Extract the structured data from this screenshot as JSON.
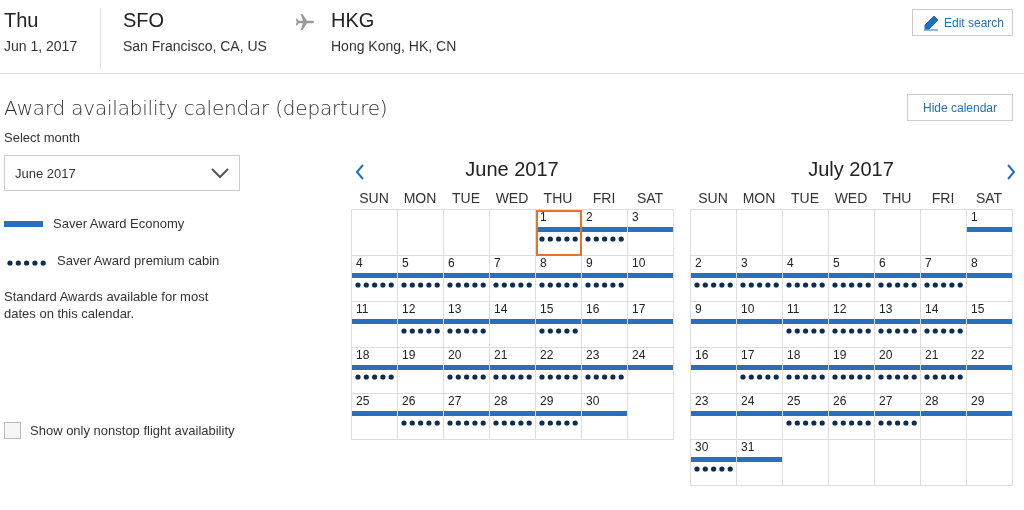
{
  "trip": {
    "day": "Thu",
    "date": "Jun 1, 2017",
    "origin_code": "SFO",
    "origin_city": "San Francisco, CA, US",
    "destination_code": "HKG",
    "destination_city": "Hong Kong, HK, CN"
  },
  "edit_button": "Edit search",
  "title": "Award availability calendar (departure)",
  "hide_button": "Hide calendar",
  "month_select": {
    "label": "Select month",
    "value": "June 2017"
  },
  "legend": [
    {
      "kind": "bar",
      "label": "Saver Award Economy"
    },
    {
      "kind": "dots",
      "label": "Saver Award premium cabin"
    }
  ],
  "note": "Standard Awards available for most dates on this calendar.",
  "nonstop": {
    "label": "Show only nonstop flight availability",
    "checked": false
  },
  "months": [
    {
      "title": "June 2017",
      "weekdays": [
        "SUN",
        "MON",
        "TUE",
        "WED",
        "THU",
        "FRI",
        "SAT"
      ],
      "weeks": [
        {
          "cells": [
            {
              "kind": "empty"
            },
            {
              "kind": "empty"
            },
            {
              "kind": "empty"
            },
            {
              "kind": "empty"
            },
            {
              "kind": "day",
              "day": "1",
              "economy": true,
              "premium": true,
              "selected": true
            },
            {
              "kind": "day",
              "day": "2",
              "economy": true,
              "premium": true,
              "selected": false
            },
            {
              "kind": "day",
              "day": "3",
              "economy": true,
              "premium": false,
              "selected": false
            }
          ]
        },
        {
          "cells": [
            {
              "kind": "day",
              "day": "4",
              "economy": true,
              "premium": true,
              "selected": false
            },
            {
              "kind": "day",
              "day": "5",
              "economy": true,
              "premium": true,
              "selected": false
            },
            {
              "kind": "day",
              "day": "6",
              "economy": true,
              "premium": true,
              "selected": false
            },
            {
              "kind": "day",
              "day": "7",
              "economy": true,
              "premium": true,
              "selected": false
            },
            {
              "kind": "day",
              "day": "8",
              "economy": true,
              "premium": true,
              "selected": false
            },
            {
              "kind": "day",
              "day": "9",
              "economy": true,
              "premium": true,
              "selected": false
            },
            {
              "kind": "day",
              "day": "10",
              "economy": true,
              "premium": false,
              "selected": false
            }
          ]
        },
        {
          "cells": [
            {
              "kind": "day",
              "day": "11",
              "economy": true,
              "premium": false,
              "selected": false
            },
            {
              "kind": "day",
              "day": "12",
              "economy": true,
              "premium": true,
              "selected": false
            },
            {
              "kind": "day",
              "day": "13",
              "economy": true,
              "premium": true,
              "selected": false
            },
            {
              "kind": "day",
              "day": "14",
              "economy": true,
              "premium": false,
              "selected": false
            },
            {
              "kind": "day",
              "day": "15",
              "economy": true,
              "premium": true,
              "selected": false
            },
            {
              "kind": "day",
              "day": "16",
              "economy": true,
              "premium": false,
              "selected": false
            },
            {
              "kind": "day",
              "day": "17",
              "economy": true,
              "premium": false,
              "selected": false
            }
          ]
        },
        {
          "cells": [
            {
              "kind": "day",
              "day": "18",
              "economy": true,
              "premium": true,
              "selected": false
            },
            {
              "kind": "day",
              "day": "19",
              "economy": true,
              "premium": false,
              "selected": false
            },
            {
              "kind": "day",
              "day": "20",
              "economy": true,
              "premium": true,
              "selected": false
            },
            {
              "kind": "day",
              "day": "21",
              "economy": true,
              "premium": true,
              "selected": false
            },
            {
              "kind": "day",
              "day": "22",
              "economy": true,
              "premium": true,
              "selected": false
            },
            {
              "kind": "day",
              "day": "23",
              "economy": true,
              "premium": true,
              "selected": false
            },
            {
              "kind": "day",
              "day": "24",
              "economy": true,
              "premium": false,
              "selected": false
            }
          ]
        },
        {
          "cells": [
            {
              "kind": "day",
              "day": "25",
              "economy": true,
              "premium": false,
              "selected": false
            },
            {
              "kind": "day",
              "day": "26",
              "economy": true,
              "premium": true,
              "selected": false
            },
            {
              "kind": "day",
              "day": "27",
              "economy": true,
              "premium": true,
              "selected": false
            },
            {
              "kind": "day",
              "day": "28",
              "economy": true,
              "premium": true,
              "selected": false
            },
            {
              "kind": "day",
              "day": "29",
              "economy": true,
              "premium": true,
              "selected": false
            },
            {
              "kind": "day",
              "day": "30",
              "economy": true,
              "premium": false,
              "selected": false
            },
            {
              "kind": "empty"
            }
          ]
        }
      ]
    },
    {
      "title": "July 2017",
      "weekdays": [
        "SUN",
        "MON",
        "TUE",
        "WED",
        "THU",
        "FRI",
        "SAT"
      ],
      "weeks": [
        {
          "cells": [
            {
              "kind": "empty"
            },
            {
              "kind": "empty"
            },
            {
              "kind": "empty"
            },
            {
              "kind": "empty"
            },
            {
              "kind": "empty"
            },
            {
              "kind": "empty"
            },
            {
              "kind": "day",
              "day": "1",
              "economy": true,
              "premium": false,
              "selected": false
            }
          ]
        },
        {
          "cells": [
            {
              "kind": "day",
              "day": "2",
              "economy": true,
              "premium": true,
              "selected": false
            },
            {
              "kind": "day",
              "day": "3",
              "economy": true,
              "premium": true,
              "selected": false
            },
            {
              "kind": "day",
              "day": "4",
              "economy": true,
              "premium": true,
              "selected": false
            },
            {
              "kind": "day",
              "day": "5",
              "economy": true,
              "premium": true,
              "selected": false
            },
            {
              "kind": "day",
              "day": "6",
              "economy": true,
              "premium": true,
              "selected": false
            },
            {
              "kind": "day",
              "day": "7",
              "economy": true,
              "premium": true,
              "selected": false
            },
            {
              "kind": "day",
              "day": "8",
              "economy": true,
              "premium": false,
              "selected": false
            }
          ]
        },
        {
          "cells": [
            {
              "kind": "day",
              "day": "9",
              "economy": true,
              "premium": false,
              "selected": false
            },
            {
              "kind": "day",
              "day": "10",
              "economy": true,
              "premium": false,
              "selected": false
            },
            {
              "kind": "day",
              "day": "11",
              "economy": true,
              "premium": true,
              "selected": false
            },
            {
              "kind": "day",
              "day": "12",
              "economy": true,
              "premium": true,
              "selected": false
            },
            {
              "kind": "day",
              "day": "13",
              "economy": true,
              "premium": true,
              "selected": false
            },
            {
              "kind": "day",
              "day": "14",
              "economy": true,
              "premium": true,
              "selected": false
            },
            {
              "kind": "day",
              "day": "15",
              "economy": true,
              "premium": false,
              "selected": false
            }
          ]
        },
        {
          "cells": [
            {
              "kind": "day",
              "day": "16",
              "economy": true,
              "premium": false,
              "selected": false
            },
            {
              "kind": "day",
              "day": "17",
              "economy": true,
              "premium": true,
              "selected": false
            },
            {
              "kind": "day",
              "day": "18",
              "economy": true,
              "premium": true,
              "selected": false
            },
            {
              "kind": "day",
              "day": "19",
              "economy": true,
              "premium": true,
              "selected": false
            },
            {
              "kind": "day",
              "day": "20",
              "economy": true,
              "premium": true,
              "selected": false
            },
            {
              "kind": "day",
              "day": "21",
              "economy": true,
              "premium": true,
              "selected": false
            },
            {
              "kind": "day",
              "day": "22",
              "economy": true,
              "premium": false,
              "selected": false
            }
          ]
        },
        {
          "cells": [
            {
              "kind": "day",
              "day": "23",
              "economy": true,
              "premium": false,
              "selected": false
            },
            {
              "kind": "day",
              "day": "24",
              "economy": true,
              "premium": false,
              "selected": false
            },
            {
              "kind": "day",
              "day": "25",
              "economy": true,
              "premium": true,
              "selected": false
            },
            {
              "kind": "day",
              "day": "26",
              "economy": true,
              "premium": true,
              "selected": false
            },
            {
              "kind": "day",
              "day": "27",
              "economy": true,
              "premium": true,
              "selected": false
            },
            {
              "kind": "day",
              "day": "28",
              "economy": true,
              "premium": false,
              "selected": false
            },
            {
              "kind": "day",
              "day": "29",
              "economy": true,
              "premium": false,
              "selected": false
            }
          ]
        },
        {
          "cells": [
            {
              "kind": "day",
              "day": "30",
              "economy": true,
              "premium": true,
              "selected": false
            },
            {
              "kind": "day",
              "day": "31",
              "economy": true,
              "premium": false,
              "selected": false
            },
            {
              "kind": "empty"
            },
            {
              "kind": "empty"
            },
            {
              "kind": "empty"
            },
            {
              "kind": "empty"
            },
            {
              "kind": "empty"
            }
          ]
        }
      ]
    }
  ]
}
